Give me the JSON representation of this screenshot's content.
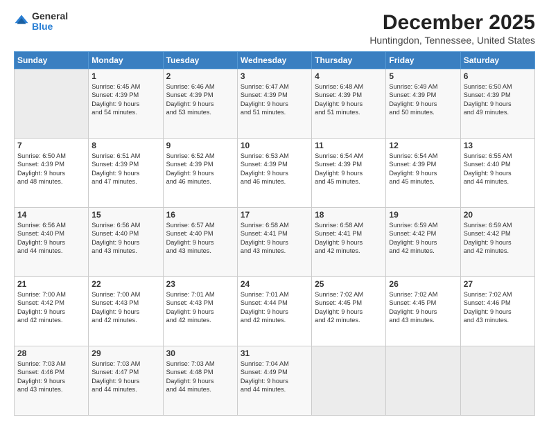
{
  "logo": {
    "general": "General",
    "blue": "Blue"
  },
  "title": "December 2025",
  "subtitle": "Huntingdon, Tennessee, United States",
  "days_header": [
    "Sunday",
    "Monday",
    "Tuesday",
    "Wednesday",
    "Thursday",
    "Friday",
    "Saturday"
  ],
  "weeks": [
    [
      {
        "day": "",
        "data": ""
      },
      {
        "day": "1",
        "data": "Sunrise: 6:45 AM\nSunset: 4:39 PM\nDaylight: 9 hours\nand 54 minutes."
      },
      {
        "day": "2",
        "data": "Sunrise: 6:46 AM\nSunset: 4:39 PM\nDaylight: 9 hours\nand 53 minutes."
      },
      {
        "day": "3",
        "data": "Sunrise: 6:47 AM\nSunset: 4:39 PM\nDaylight: 9 hours\nand 51 minutes."
      },
      {
        "day": "4",
        "data": "Sunrise: 6:48 AM\nSunset: 4:39 PM\nDaylight: 9 hours\nand 51 minutes."
      },
      {
        "day": "5",
        "data": "Sunrise: 6:49 AM\nSunset: 4:39 PM\nDaylight: 9 hours\nand 50 minutes."
      },
      {
        "day": "6",
        "data": "Sunrise: 6:50 AM\nSunset: 4:39 PM\nDaylight: 9 hours\nand 49 minutes."
      }
    ],
    [
      {
        "day": "7",
        "data": "Sunrise: 6:50 AM\nSunset: 4:39 PM\nDaylight: 9 hours\nand 48 minutes."
      },
      {
        "day": "8",
        "data": "Sunrise: 6:51 AM\nSunset: 4:39 PM\nDaylight: 9 hours\nand 47 minutes."
      },
      {
        "day": "9",
        "data": "Sunrise: 6:52 AM\nSunset: 4:39 PM\nDaylight: 9 hours\nand 46 minutes."
      },
      {
        "day": "10",
        "data": "Sunrise: 6:53 AM\nSunset: 4:39 PM\nDaylight: 9 hours\nand 46 minutes."
      },
      {
        "day": "11",
        "data": "Sunrise: 6:54 AM\nSunset: 4:39 PM\nDaylight: 9 hours\nand 45 minutes."
      },
      {
        "day": "12",
        "data": "Sunrise: 6:54 AM\nSunset: 4:39 PM\nDaylight: 9 hours\nand 45 minutes."
      },
      {
        "day": "13",
        "data": "Sunrise: 6:55 AM\nSunset: 4:40 PM\nDaylight: 9 hours\nand 44 minutes."
      }
    ],
    [
      {
        "day": "14",
        "data": "Sunrise: 6:56 AM\nSunset: 4:40 PM\nDaylight: 9 hours\nand 44 minutes."
      },
      {
        "day": "15",
        "data": "Sunrise: 6:56 AM\nSunset: 4:40 PM\nDaylight: 9 hours\nand 43 minutes."
      },
      {
        "day": "16",
        "data": "Sunrise: 6:57 AM\nSunset: 4:40 PM\nDaylight: 9 hours\nand 43 minutes."
      },
      {
        "day": "17",
        "data": "Sunrise: 6:58 AM\nSunset: 4:41 PM\nDaylight: 9 hours\nand 43 minutes."
      },
      {
        "day": "18",
        "data": "Sunrise: 6:58 AM\nSunset: 4:41 PM\nDaylight: 9 hours\nand 42 minutes."
      },
      {
        "day": "19",
        "data": "Sunrise: 6:59 AM\nSunset: 4:42 PM\nDaylight: 9 hours\nand 42 minutes."
      },
      {
        "day": "20",
        "data": "Sunrise: 6:59 AM\nSunset: 4:42 PM\nDaylight: 9 hours\nand 42 minutes."
      }
    ],
    [
      {
        "day": "21",
        "data": "Sunrise: 7:00 AM\nSunset: 4:42 PM\nDaylight: 9 hours\nand 42 minutes."
      },
      {
        "day": "22",
        "data": "Sunrise: 7:00 AM\nSunset: 4:43 PM\nDaylight: 9 hours\nand 42 minutes."
      },
      {
        "day": "23",
        "data": "Sunrise: 7:01 AM\nSunset: 4:43 PM\nDaylight: 9 hours\nand 42 minutes."
      },
      {
        "day": "24",
        "data": "Sunrise: 7:01 AM\nSunset: 4:44 PM\nDaylight: 9 hours\nand 42 minutes."
      },
      {
        "day": "25",
        "data": "Sunrise: 7:02 AM\nSunset: 4:45 PM\nDaylight: 9 hours\nand 42 minutes."
      },
      {
        "day": "26",
        "data": "Sunrise: 7:02 AM\nSunset: 4:45 PM\nDaylight: 9 hours\nand 43 minutes."
      },
      {
        "day": "27",
        "data": "Sunrise: 7:02 AM\nSunset: 4:46 PM\nDaylight: 9 hours\nand 43 minutes."
      }
    ],
    [
      {
        "day": "28",
        "data": "Sunrise: 7:03 AM\nSunset: 4:46 PM\nDaylight: 9 hours\nand 43 minutes."
      },
      {
        "day": "29",
        "data": "Sunrise: 7:03 AM\nSunset: 4:47 PM\nDaylight: 9 hours\nand 44 minutes."
      },
      {
        "day": "30",
        "data": "Sunrise: 7:03 AM\nSunset: 4:48 PM\nDaylight: 9 hours\nand 44 minutes."
      },
      {
        "day": "31",
        "data": "Sunrise: 7:04 AM\nSunset: 4:49 PM\nDaylight: 9 hours\nand 44 minutes."
      },
      {
        "day": "",
        "data": ""
      },
      {
        "day": "",
        "data": ""
      },
      {
        "day": "",
        "data": ""
      }
    ]
  ]
}
